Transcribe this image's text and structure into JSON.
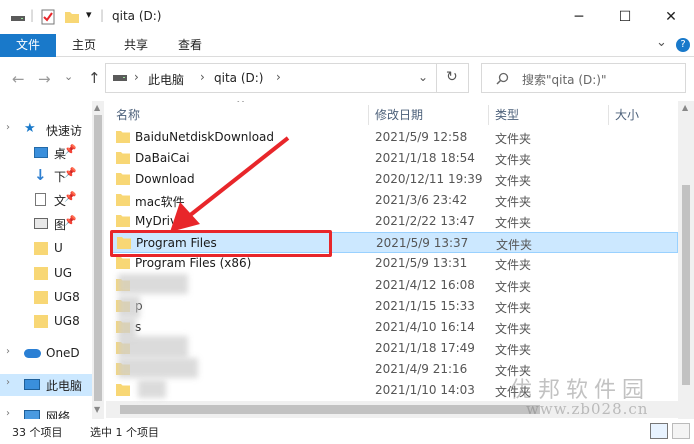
{
  "window": {
    "title": "qita (D:)",
    "min_glyph": "─",
    "max_glyph": "☐",
    "close_glyph": "✕"
  },
  "ribbon": {
    "tabs": [
      "文件",
      "主页",
      "共享",
      "查看"
    ],
    "expand_glyph": "⌄",
    "help_glyph": "?"
  },
  "address": {
    "crumbs": [
      "此电脑",
      "qita (D:)"
    ],
    "sep_glyph": "›",
    "dropdown_glyph": "⌄",
    "refresh_glyph": "↻",
    "search_placeholder": "搜索\"qita (D:)\""
  },
  "nav": {
    "back_glyph": "←",
    "forward_glyph": "→",
    "dropdown_glyph": "⌄",
    "up_glyph": "↑",
    "items": [
      {
        "label": "快速访",
        "icon": "star-icon"
      },
      {
        "label": "桌",
        "icon": "desktop-icon"
      },
      {
        "label": "下",
        "icon": "download-icon"
      },
      {
        "label": "文",
        "icon": "document-icon"
      },
      {
        "label": "图",
        "icon": "picture-icon"
      },
      {
        "label": "U",
        "icon": "folder-icon"
      },
      {
        "label": "UG",
        "icon": "folder-icon"
      },
      {
        "label": "UG8",
        "icon": "folder-icon"
      },
      {
        "label": "UG8",
        "icon": "folder-icon"
      },
      {
        "label": "OneD",
        "icon": "cloud-icon"
      },
      {
        "label": "此电脑",
        "icon": "computer-icon"
      },
      {
        "label": "网络",
        "icon": "network-icon"
      }
    ]
  },
  "columns": {
    "name": "名称",
    "date": "修改日期",
    "type": "类型",
    "size": "大小",
    "sort_glyph": "^"
  },
  "files": [
    {
      "name": "BaiduNetdiskDownload",
      "date": "2021/5/9 12:58",
      "type": "文件夹"
    },
    {
      "name": "DaBaiCai",
      "date": "2021/1/18 18:54",
      "type": "文件夹"
    },
    {
      "name": "Download",
      "date": "2020/12/11 19:39",
      "type": "文件夹"
    },
    {
      "name": "mac软件",
      "date": "2021/3/6 23:42",
      "type": "文件夹"
    },
    {
      "name": "MyDrivers",
      "date": "2021/2/22 13:47",
      "type": "文件夹"
    },
    {
      "name": "Program Files",
      "date": "2021/5/9 13:37",
      "type": "文件夹",
      "selected": true
    },
    {
      "name": "Program Files (x86)",
      "date": "2021/5/9 13:31",
      "type": "文件夹"
    },
    {
      "name": "",
      "date": "2021/4/12 16:08",
      "type": "文件夹"
    },
    {
      "name": "p",
      "date": "2021/1/15 15:33",
      "type": "文件夹"
    },
    {
      "name": "s",
      "date": "2021/4/10 16:14",
      "type": "文件夹"
    },
    {
      "name": "",
      "date": "2021/1/18 17:49",
      "type": "文件夹"
    },
    {
      "name": "",
      "date": "2021/4/9 21:16",
      "type": "文件夹"
    },
    {
      "name": "",
      "date": "2021/1/10 14:03",
      "type": "文件夹"
    }
  ],
  "status": {
    "count": "33 个项目",
    "selected": "选中 1 个项目"
  },
  "watermark": {
    "text": "优邦软件园",
    "url": "www.zb028.cn"
  },
  "colors": {
    "accent": "#1979ca",
    "selection": "#cce8ff",
    "folder": "#f8d775",
    "highlight_box": "#e8262a"
  }
}
